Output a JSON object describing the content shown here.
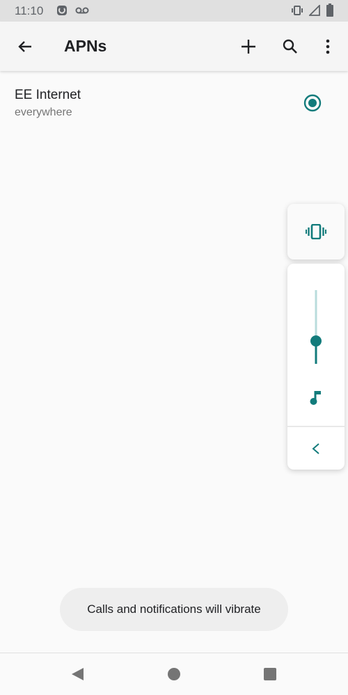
{
  "status_bar": {
    "time": "11:10",
    "icons": [
      "notification-app-icon",
      "voicemail-icon",
      "vibrate-icon",
      "signal-icon",
      "battery-icon"
    ]
  },
  "app_bar": {
    "title": "APNs",
    "back_icon": "arrow-back-icon",
    "actions": [
      "add-icon",
      "search-icon",
      "more-vert-icon"
    ]
  },
  "apn_list": [
    {
      "name": "EE Internet",
      "apn": "everywhere",
      "selected": true
    }
  ],
  "volume_panel": {
    "ringer_mode": "vibrate",
    "stream": "music",
    "level": 0.31,
    "accent": "#127b7b"
  },
  "toast": "Calls and notifications will vibrate",
  "colors": {
    "accent": "#127b7b",
    "status_bar": "#e0e0e0"
  }
}
